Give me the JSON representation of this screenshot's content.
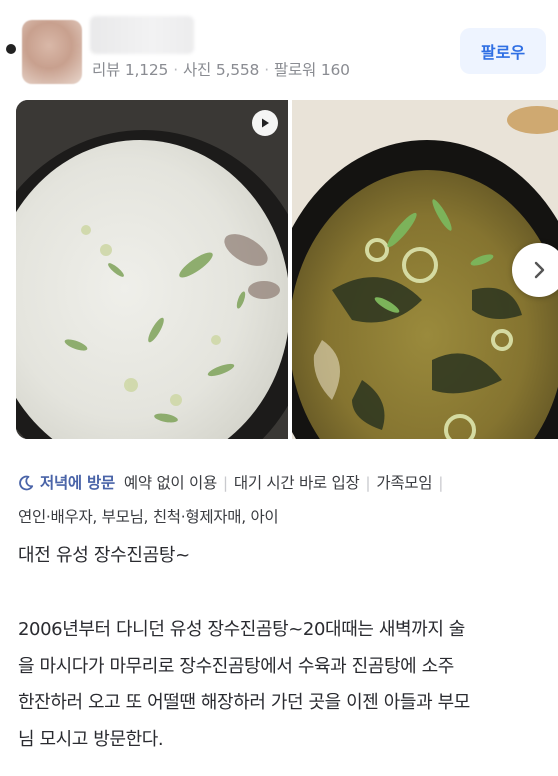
{
  "profile": {
    "stats": {
      "reviews": "리뷰 1,125",
      "photos": "사진 5,558",
      "followers": "팔로워 160"
    },
    "follow_label": "팔로우"
  },
  "photos": {
    "items": [
      {
        "alt": "seolleongtang bowl"
      },
      {
        "alt": "jingomtang bowl with green onions"
      }
    ]
  },
  "tags": {
    "visit_time": "저녁에 방문",
    "items": [
      "예약 없이 이용",
      "대기 시간 바로 입장",
      "가족모임",
      "연인·배우자, 부모님, 친척·형제자매, 아이"
    ]
  },
  "review": {
    "title": "대전 유성 장수진곰탕~",
    "lines": [
      "2006년부터 다니던 유성 장수진곰탕~20대때는 새벽까지 술",
      "을 마시다가 마무리로 장수진곰탕에서 수육과 진곰탕에 소주",
      "한잔하러 오고 또 어떨땐 해장하러 가던 곳을 이젠 아들과 부모",
      "님 모시고 방문한다."
    ]
  },
  "colors": {
    "accent_blue": "#2f6fe4",
    "follow_bg": "#eef4ff",
    "visit_color": "#4a64a8",
    "meta_gray": "#8a8c92"
  },
  "icons": [
    "play-icon",
    "chevron-right-icon",
    "moon-icon"
  ]
}
